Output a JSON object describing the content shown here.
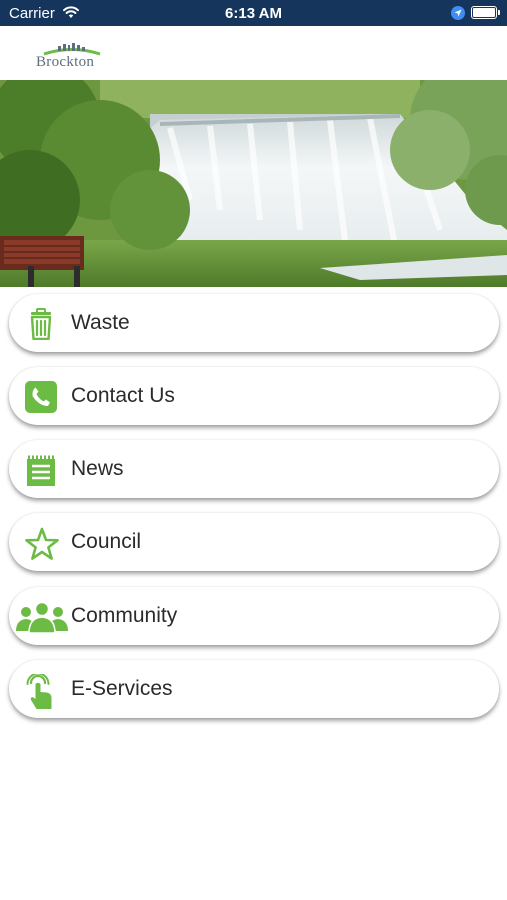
{
  "status_bar": {
    "carrier": "Carrier",
    "time": "6:13 AM"
  },
  "header": {
    "logo_text": "Brockton"
  },
  "menu": {
    "accent_color": "#6cbb45",
    "items": [
      {
        "label": "Waste",
        "icon": "trash-icon"
      },
      {
        "label": "Contact Us",
        "icon": "phone-icon"
      },
      {
        "label": "News",
        "icon": "notepad-icon"
      },
      {
        "label": "Council",
        "icon": "star-icon"
      },
      {
        "label": "Community",
        "icon": "people-icon"
      },
      {
        "label": "E-Services",
        "icon": "tap-hand-icon"
      }
    ]
  }
}
